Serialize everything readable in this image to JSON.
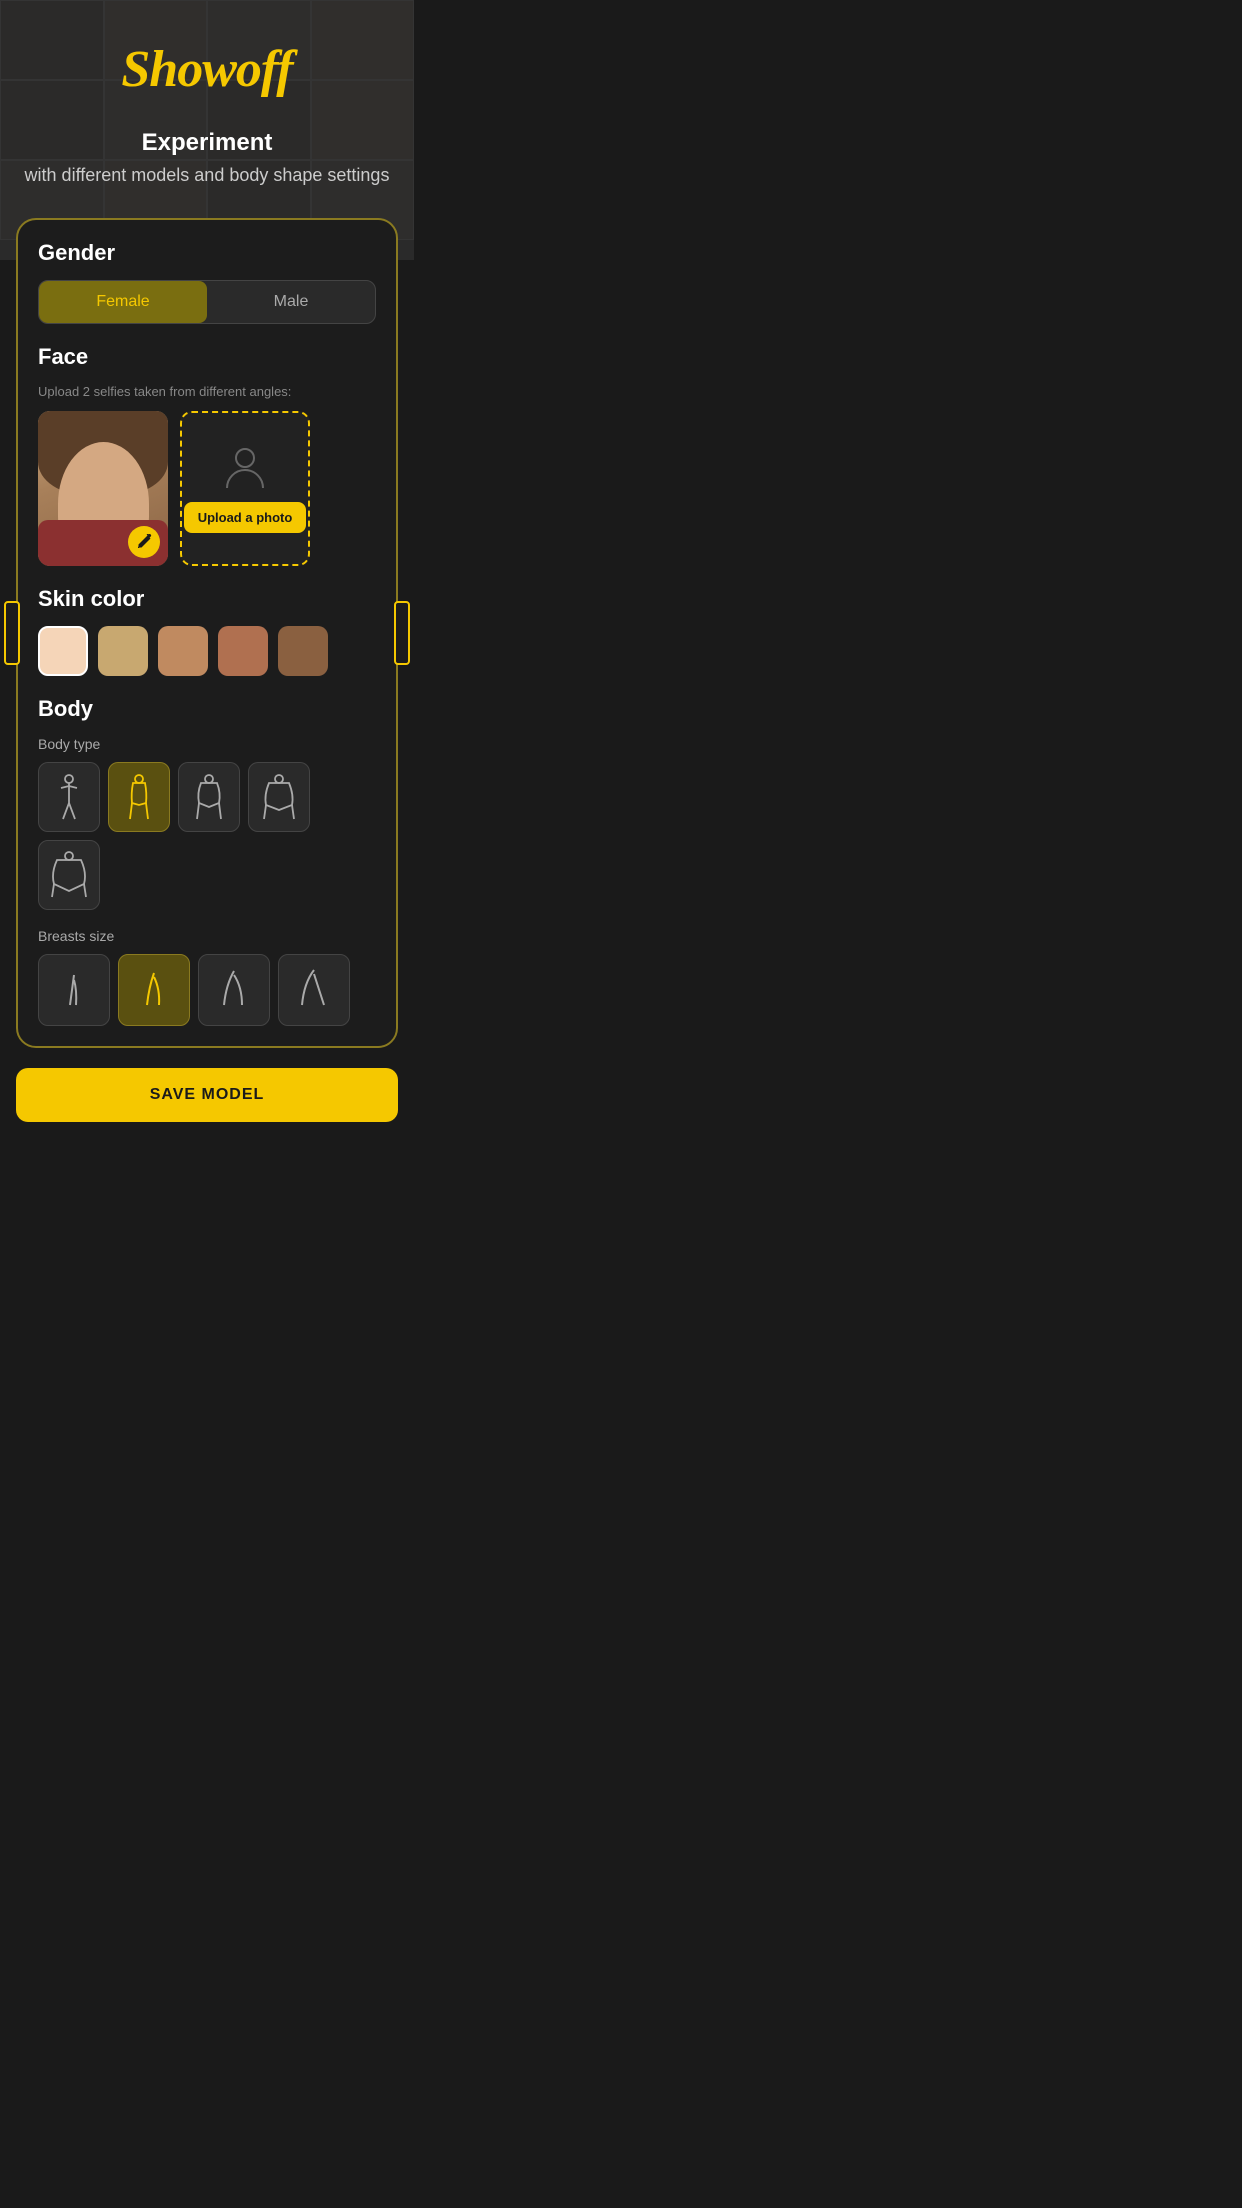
{
  "app": {
    "title": "Showoff"
  },
  "hero": {
    "title": "Experiment",
    "subtitle": "with different models and body shape settings"
  },
  "gender": {
    "label": "Gender",
    "options": [
      "Female",
      "Male"
    ],
    "selected": "Female"
  },
  "face": {
    "label": "Face",
    "subtitle": "Upload 2 selfies taken from different angles:",
    "slot1_has_photo": true,
    "slot2_has_photo": false,
    "upload_btn_label": "Upload a photo"
  },
  "skin_color": {
    "label": "Skin color",
    "swatches": [
      "#f5d5b8",
      "#c8a870",
      "#c08a60",
      "#b07050",
      "#8a6040"
    ],
    "selected_index": 0
  },
  "body": {
    "label": "Body",
    "body_type": {
      "label": "Body type",
      "selected_index": 1
    },
    "breasts_size": {
      "label": "Breasts size",
      "selected_index": 1
    }
  },
  "save_btn_label": "SAVE MODEL"
}
